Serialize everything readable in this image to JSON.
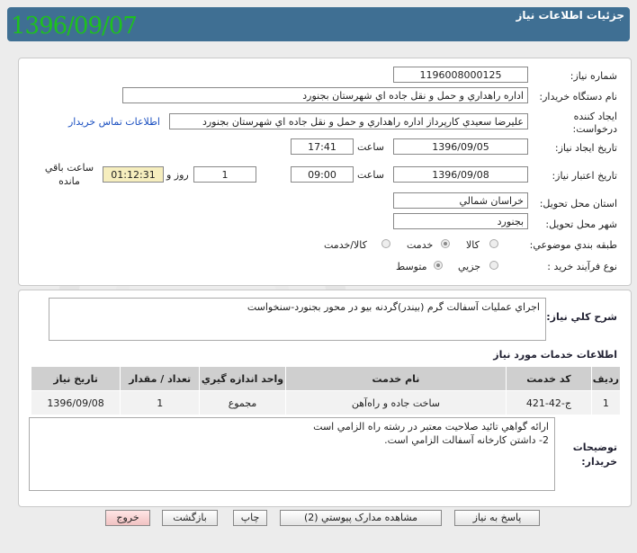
{
  "header": {
    "title": "جزئيات اطلاعات نياز",
    "date_big": "1396/09/07"
  },
  "form": {
    "need_number_label": "شماره نياز:",
    "need_number": "1196008000125",
    "buyer_label": "نام دستگاه خريدار:",
    "buyer": "اداره راهداري و حمل و نقل جاده اي شهرستان بجنورد",
    "creator_label_1": "ايجاد کننده",
    "creator_label_2": "درخواست:",
    "creator": "عليرضا سعيدي کارپرداز اداره راهداري و حمل و نقل جاده اي شهرستان بجنورد",
    "contact_link": "اطلاعات تماس خريدار",
    "created_label": "تاريخ ايجاد نياز:",
    "created_date": "1396/09/05",
    "time_label": "ساعت",
    "created_time": "17:41",
    "valid_label": "تاريخ اعتبار نياز:",
    "valid_date": "1396/09/08",
    "valid_time": "09:00",
    "days_value": "1",
    "day_and_label": "روز و",
    "remaining": "01:12:31",
    "remaining_label_1": "ساعت باقي",
    "remaining_label_2": "مانده",
    "province_label": "استان محل تحويل:",
    "province": "خراسان شمالي",
    "city_label": "شهر محل تحويل:",
    "city": "بجنورد",
    "category_label": "طبقه بندي موضوعي:",
    "cat_goods": "کالا",
    "cat_service": "خدمت",
    "cat_goods_service": "کالا/خدمت",
    "process_label": "نوع فرآيند خريد :",
    "proc_partial": "جزيي",
    "proc_medium": "متوسط"
  },
  "description": {
    "label": "شرح کلي نياز:",
    "text": "اجراي عمليات آسفالت گرم (بيندر)گردنه بيو در محور بجنورد-سنخواست"
  },
  "services": {
    "title": "اطلاعات خدمات مورد نياز",
    "columns": [
      "رديف",
      "کد خدمت",
      "نام خدمت",
      "واحد اندازه گيري",
      "تعداد / مقدار",
      "تاريخ نياز"
    ],
    "rows": [
      {
        "row": "1",
        "code": "ج-42-421",
        "name": "ساخت جاده و راه‌آهن",
        "unit": "مجموع",
        "qty": "1",
        "date": "1396/09/08"
      }
    ]
  },
  "notes": {
    "label_1": "توضيحات",
    "label_2": "خريدار:",
    "line1": "ارائه گواهي تائيد صلاحيت معتبر در رشته راه الزامي است",
    "line2": "2- داشتن کارخانه آسفالت الزامي است."
  },
  "buttons": {
    "respond": "پاسخ به نياز",
    "attachments": "مشاهده مدارک پيوستي (2)",
    "print": "چاپ",
    "back": "بازگشت",
    "exit": "خروج"
  }
}
